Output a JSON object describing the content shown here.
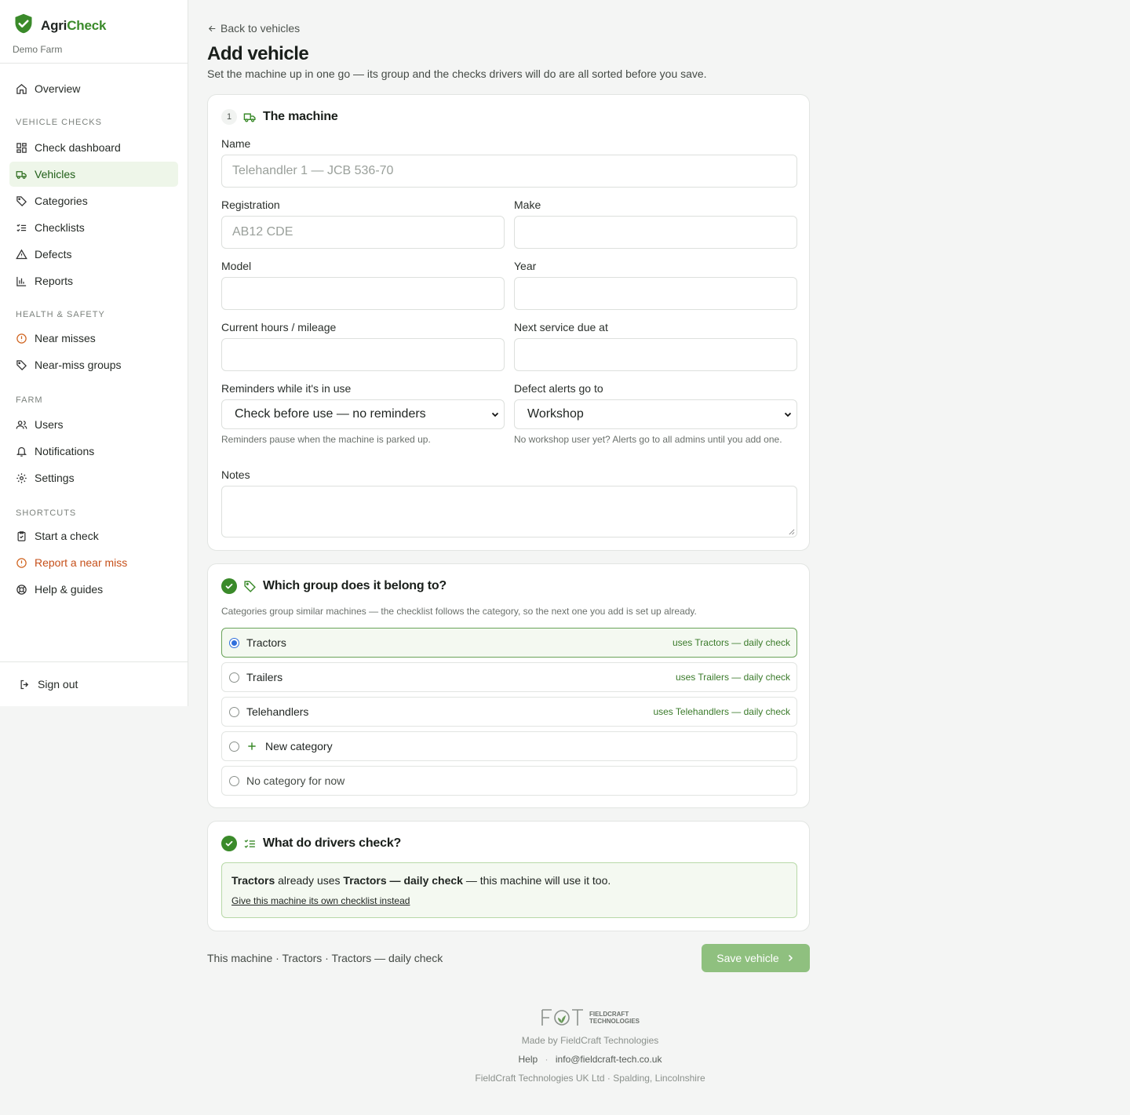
{
  "brand": {
    "name_part1": "Agri",
    "name_part2": "Check",
    "farm": "Demo Farm",
    "accent_color": "#3a8a2a"
  },
  "sidebar": {
    "overview": "Overview",
    "sections": {
      "vehicle_checks": "VEHICLE CHECKS",
      "health_safety": "HEALTH & SAFETY",
      "farm": "FARM",
      "shortcuts": "SHORTCUTS"
    },
    "vehicle_checks": [
      "Check dashboard",
      "Vehicles",
      "Categories",
      "Checklists",
      "Defects",
      "Reports"
    ],
    "health_safety": [
      "Near misses",
      "Near-miss groups"
    ],
    "farm": [
      "Users",
      "Notifications",
      "Settings"
    ],
    "shortcuts": [
      "Start a check",
      "Report a near miss",
      "Help & guides"
    ],
    "signout": "Sign out",
    "active_item": "Vehicles"
  },
  "header": {
    "back": "Back to vehicles",
    "title": "Add vehicle",
    "subtitle": "Set the machine up in one go — its group and the checks drivers will do are all sorted before you save."
  },
  "machine": {
    "step": "1",
    "title": "The machine",
    "name_label": "Name",
    "name_placeholder": "Telehandler 1 — JCB 536-70",
    "registration_label": "Registration",
    "registration_placeholder": "AB12 CDE",
    "make_label": "Make",
    "model_label": "Model",
    "year_label": "Year",
    "hours_label": "Current hours / mileage",
    "service_label": "Next service due at",
    "reminders_label": "Reminders while it's in use",
    "reminders_value": "Check before use — no reminders",
    "reminders_hint": "Reminders pause when the machine is parked up.",
    "alerts_label": "Defect alerts go to",
    "alerts_value": "Workshop",
    "alerts_hint": "No workshop user yet? Alerts go to all admins until you add one.",
    "notes_label": "Notes"
  },
  "group": {
    "title": "Which group does it belong to?",
    "description": "Categories group similar machines — the checklist follows the category, so the next one you add is set up already.",
    "options": [
      {
        "label": "Tractors",
        "tag": "uses Tractors — daily check",
        "selected": true
      },
      {
        "label": "Trailers",
        "tag": "uses Trailers — daily check",
        "selected": false
      },
      {
        "label": "Telehandlers",
        "tag": "uses Telehandlers — daily check",
        "selected": false
      },
      {
        "label": "New category",
        "tag": "",
        "selected": false
      },
      {
        "label": "No category for now",
        "tag": "",
        "selected": false
      }
    ]
  },
  "checks": {
    "title": "What do drivers check?",
    "category": "Tractors",
    "middle": "already uses",
    "checklist": "Tractors — daily check",
    "tail": "— this machine will use it too.",
    "link": "Give this machine its own checklist instead"
  },
  "summary": "This machine · Tractors · Tractors — daily check",
  "save_button": "Save vehicle",
  "footer": {
    "logo_line1": "FIELDCRAFT",
    "logo_line2": "TECHNOLOGIES",
    "made_by": "Made by FieldCraft Technologies",
    "help": "Help",
    "separator": "·",
    "email": "info@fieldcraft-tech.co.uk",
    "company": "FieldCraft Technologies UK Ltd · Spalding, Lincolnshire"
  }
}
